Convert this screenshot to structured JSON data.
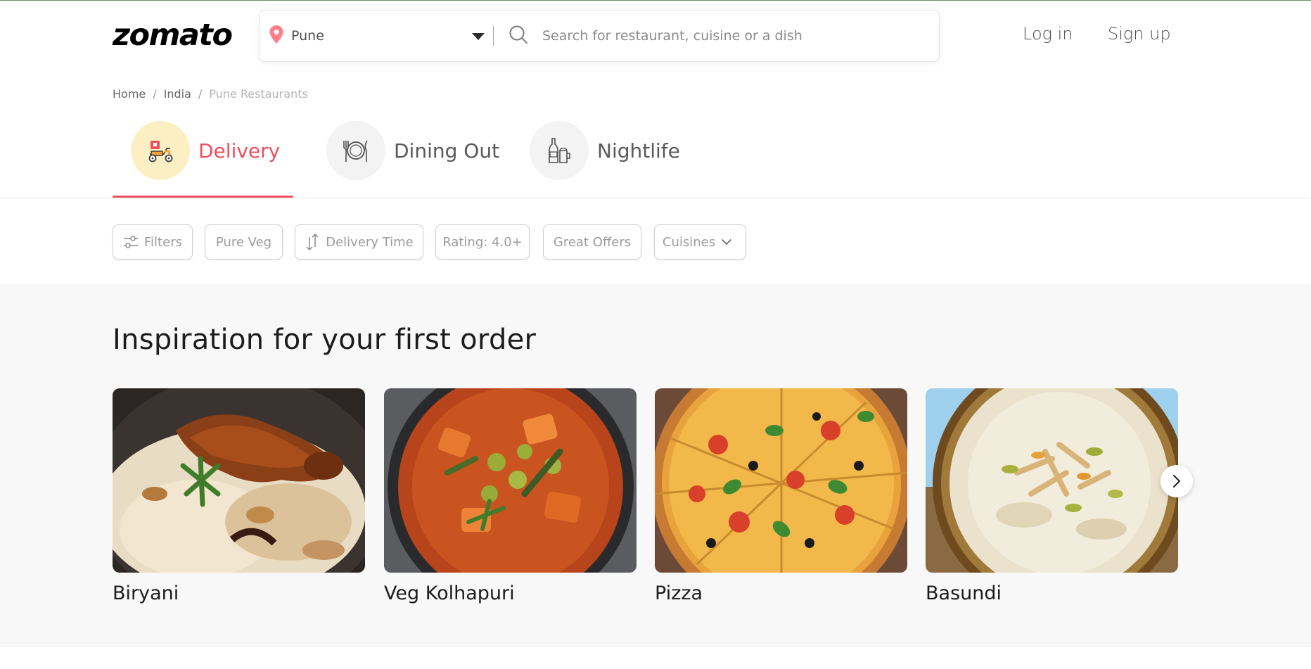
{
  "header": {
    "logo": "zomato",
    "location": "Pune",
    "search_placeholder": "Search for restaurant, cuisine or a dish",
    "login": "Log in",
    "signup": "Sign up"
  },
  "breadcrumb": [
    "Home",
    "India",
    "Pune Restaurants"
  ],
  "tabs": [
    {
      "label": "Delivery",
      "active": true
    },
    {
      "label": "Dining Out",
      "active": false
    },
    {
      "label": "Nightlife",
      "active": false
    }
  ],
  "filters": {
    "filters": "Filters",
    "pure_veg": "Pure Veg",
    "delivery_time": "Delivery Time",
    "rating": "Rating: 4.0+",
    "great_offers": "Great Offers",
    "cuisines": "Cuisines"
  },
  "inspiration": {
    "title": "Inspiration for your first order",
    "items": [
      {
        "label": "Biryani"
      },
      {
        "label": "Veg Kolhapuri"
      },
      {
        "label": "Pizza"
      },
      {
        "label": "Basundi"
      }
    ]
  },
  "colors": {
    "accent": "#ef4f5f",
    "delivery_circle": "#fcefc4",
    "section_bg": "#f8f8f8"
  },
  "icons": [
    "location-pin-icon",
    "caret-down-icon",
    "search-icon",
    "scooter-icon",
    "plate-icon",
    "bottles-icon",
    "sliders-icon",
    "sort-arrows-icon",
    "chevron-down-icon",
    "chevron-right-icon"
  ]
}
